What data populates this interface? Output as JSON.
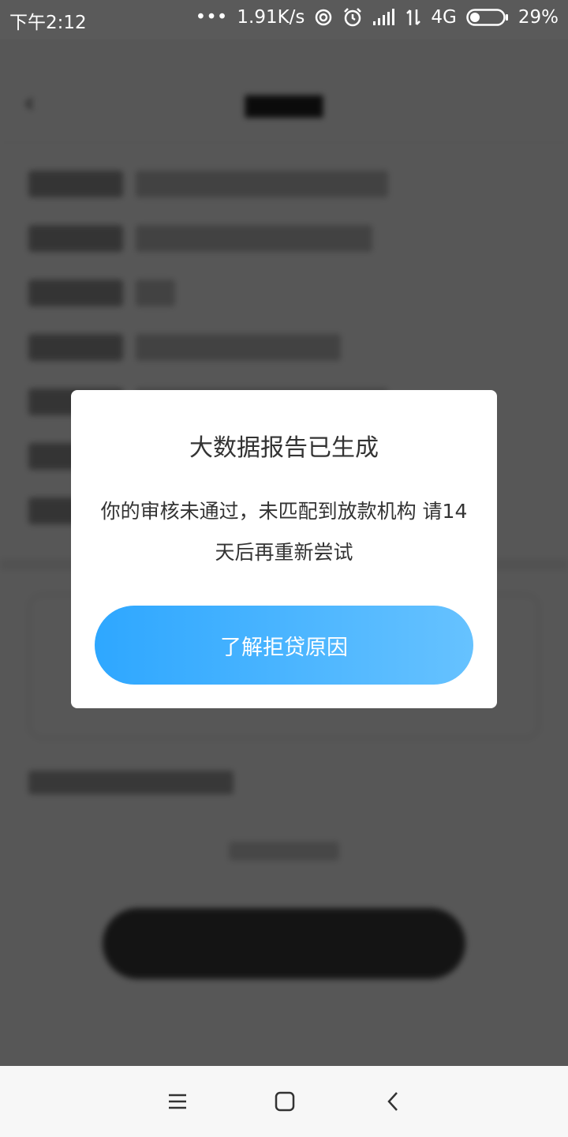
{
  "status_bar": {
    "time": "下午2:12",
    "more": "•••",
    "speed": "1.91K/s",
    "network": "4G",
    "battery_percent": "29%",
    "battery_level": 0.29,
    "icons": [
      "sync-icon",
      "alarm-icon",
      "signal-icon",
      "data-transfer-icon",
      "battery-icon"
    ]
  },
  "dialog": {
    "title": "大数据报告已生成",
    "message": "你的审核未通过，未匹配到放款机构 请14天后再重新尝试",
    "button_label": "了解拒贷原因",
    "button_gradient": [
      "#2ea7ff",
      "#66c2ff"
    ]
  },
  "nav": {
    "icons": [
      "menu-icon",
      "home-icon",
      "back-icon"
    ]
  }
}
